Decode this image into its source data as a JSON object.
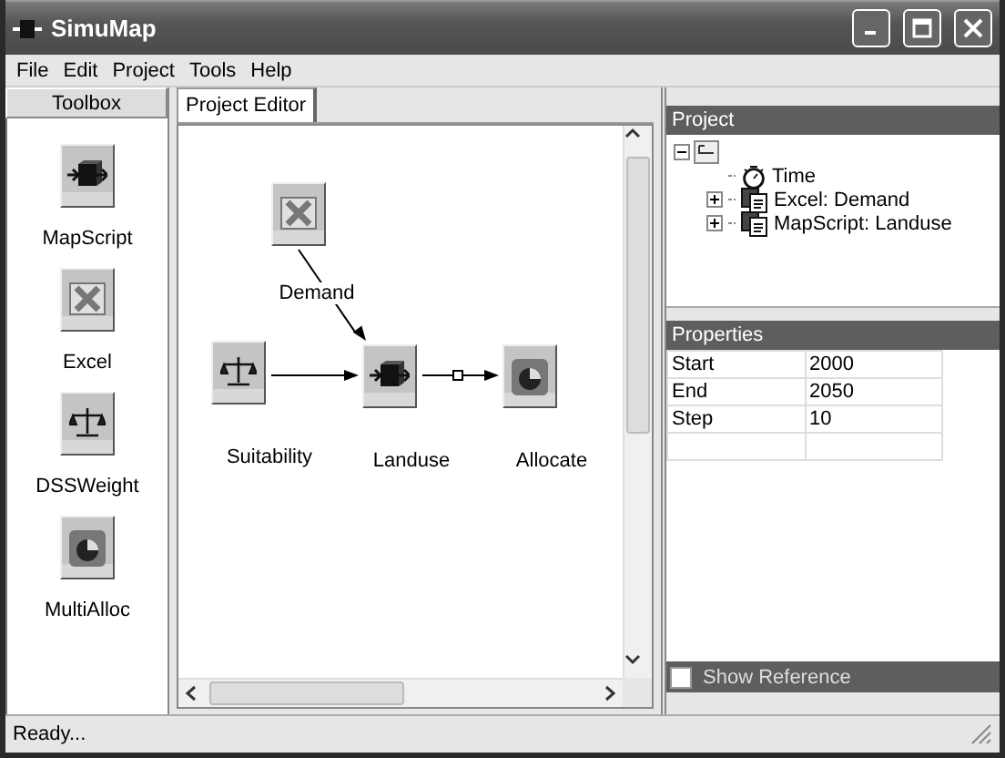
{
  "window": {
    "title": "SimuMap"
  },
  "menu": [
    "File",
    "Edit",
    "Project",
    "Tools",
    "Help"
  ],
  "toolbox": {
    "header": "Toolbox",
    "items": [
      {
        "label": "MapScript",
        "kind": "mapscript"
      },
      {
        "label": "Excel",
        "kind": "excel"
      },
      {
        "label": "DSSWeight",
        "kind": "dssweight"
      },
      {
        "label": "MultiAlloc",
        "kind": "multialloc"
      }
    ]
  },
  "tabs": [
    {
      "label": "Project Editor",
      "selected": true
    }
  ],
  "diagram": {
    "nodes": [
      {
        "label": "Demand",
        "kind": "excel"
      },
      {
        "label": "Suitability",
        "kind": "dssweight"
      },
      {
        "label": "Landuse",
        "kind": "mapscript"
      },
      {
        "label": "Allocate",
        "kind": "multialloc"
      }
    ],
    "edges": [
      {
        "kind": "plain"
      },
      {
        "kind": "plain"
      },
      {
        "kind": "marked"
      }
    ]
  },
  "project": {
    "title": "Project",
    "tree": {
      "expanded": true,
      "children": [
        {
          "label": "Time",
          "kind": "timer"
        },
        {
          "label": "Excel: Demand",
          "kind": "document",
          "expanded": false
        },
        {
          "label": "MapScript: Landuse",
          "kind": "document",
          "expanded": false
        }
      ]
    }
  },
  "properties": {
    "title": "Properties",
    "rows": [
      {
        "name": "Start",
        "value": "2000"
      },
      {
        "name": "End",
        "value": "2050"
      },
      {
        "name": "Step",
        "value": "10"
      }
    ]
  },
  "show_reference": {
    "label": "Show Reference",
    "checked": false
  },
  "status_bar": "Ready..."
}
